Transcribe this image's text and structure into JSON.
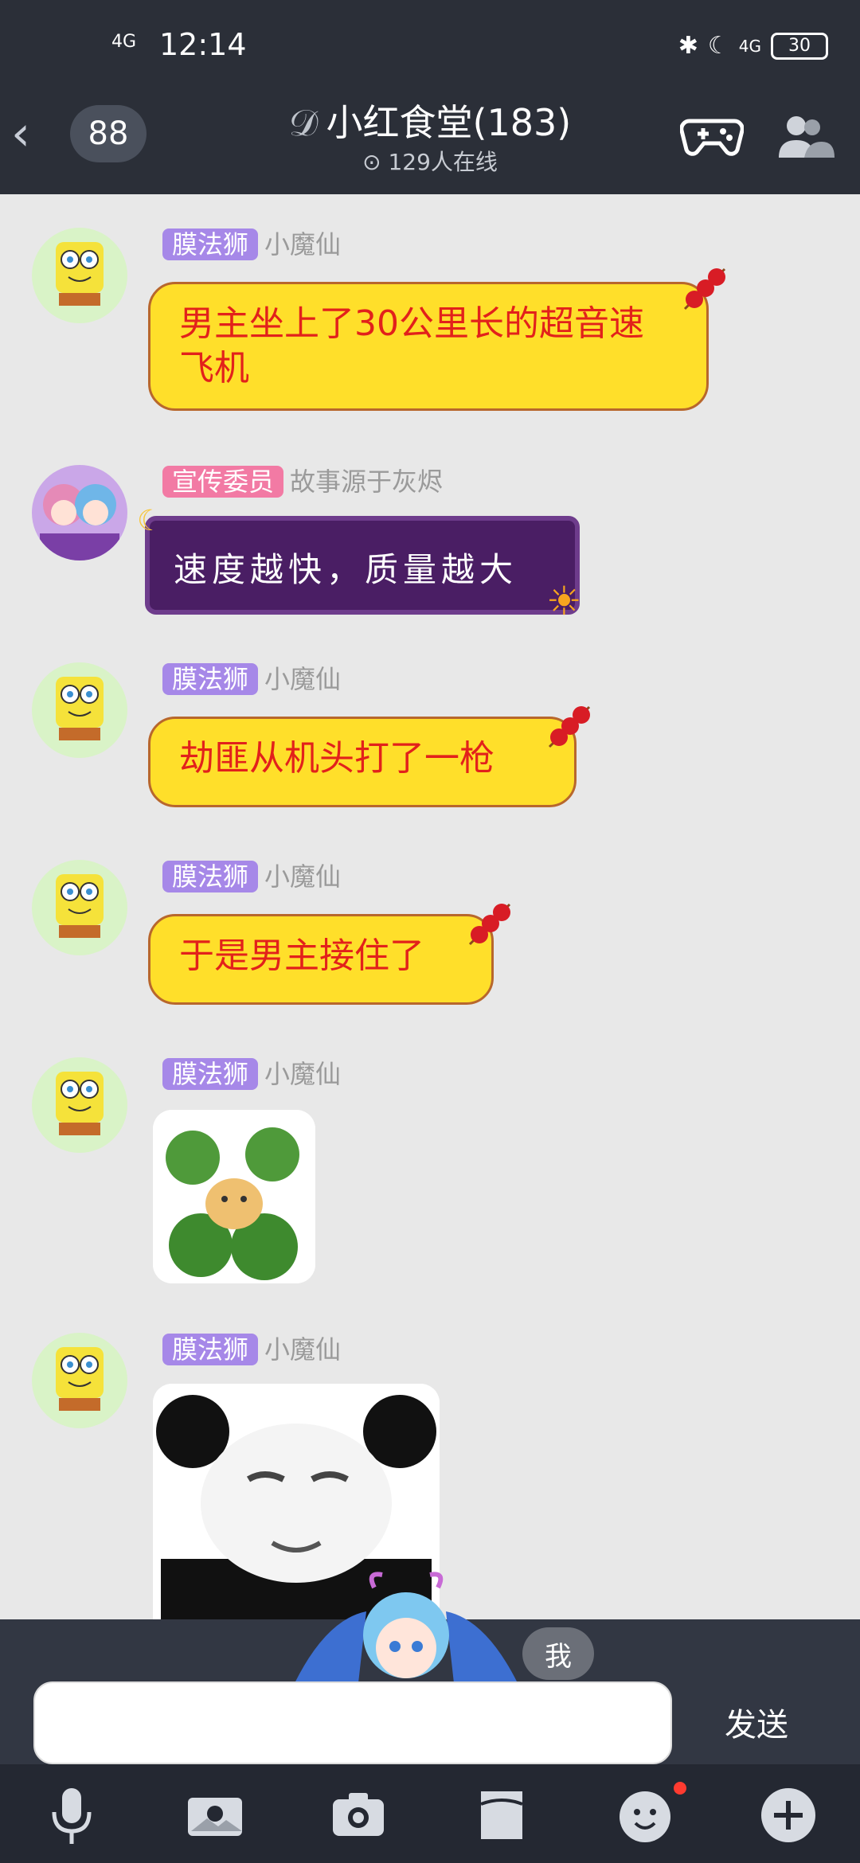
{
  "status": {
    "time": "12:14",
    "signal": "4G",
    "signal_right": "4G",
    "battery": "30"
  },
  "header": {
    "back_count": "88",
    "title": "小红食堂(183)",
    "online": "129人在线"
  },
  "messages": [
    {
      "badge": "膜法狮",
      "badge_color": "#a688e8",
      "nick": "小魔仙",
      "text": "男主坐上了30公里长的超音速飞机",
      "style": "yellow-candy"
    },
    {
      "badge": "宣传委员",
      "badge_color": "#f27aa4",
      "nick": "故事源于灰烬",
      "text": "速度越快，质量越大",
      "style": "purple-scroll"
    },
    {
      "badge": "膜法狮",
      "badge_color": "#a688e8",
      "nick": "小魔仙",
      "text": "劫匪从机头打了一枪",
      "style": "yellow-candy"
    },
    {
      "badge": "膜法狮",
      "badge_color": "#a688e8",
      "nick": "小魔仙",
      "text": "于是男主接住了",
      "style": "yellow-candy"
    },
    {
      "badge": "膜法狮",
      "badge_color": "#a688e8",
      "nick": "小魔仙",
      "type": "image",
      "image": "broccoli-sticker"
    },
    {
      "badge": "膜法狮",
      "badge_color": "#a688e8",
      "nick": "小魔仙",
      "type": "image",
      "image": "panda-meme-sticker"
    }
  ],
  "input": {
    "placeholder": "",
    "send_label": "发送",
    "me_tag": "我"
  },
  "toolbar": [
    "microphone-icon",
    "photo-icon",
    "camera-icon",
    "file-icon",
    "emoji-icon",
    "plus-icon"
  ]
}
